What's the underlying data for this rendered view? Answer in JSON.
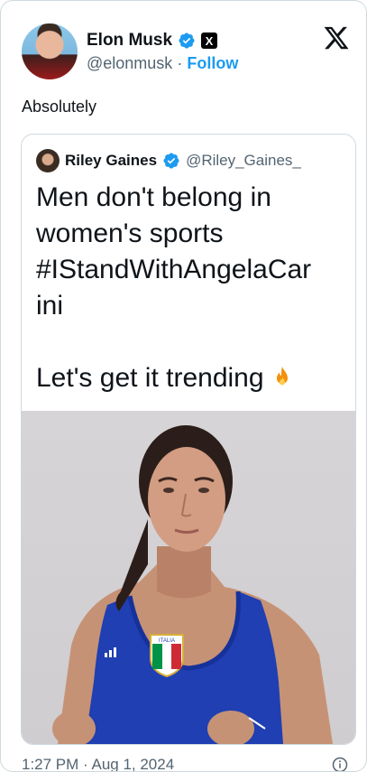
{
  "tweet": {
    "author_name": "Elon Musk",
    "author_handle": "@elonmusk",
    "separator": "·",
    "follow_label": "Follow",
    "text": "Absolutely",
    "x_badge": "X",
    "timestamp": "1:27 PM · Aug 1, 2024"
  },
  "quote": {
    "author_name": "Riley Gaines",
    "author_handle": "@Riley_Gaines_",
    "line1": "Men don't belong in",
    "line2": "women's sports",
    "line3": "#IStandWithAngelaCar",
    "line4": "ini",
    "line5": "Let's get it trending"
  },
  "photo": {
    "badge_text": "ITALIA"
  },
  "icons": {
    "verified": "verified-badge-icon",
    "x": "x-logo-icon",
    "fire": "fire-emoji",
    "info": "info-icon"
  },
  "colors": {
    "accent": "#1d9bf0",
    "muted": "#536471",
    "jersey": "#1f3fb2"
  }
}
